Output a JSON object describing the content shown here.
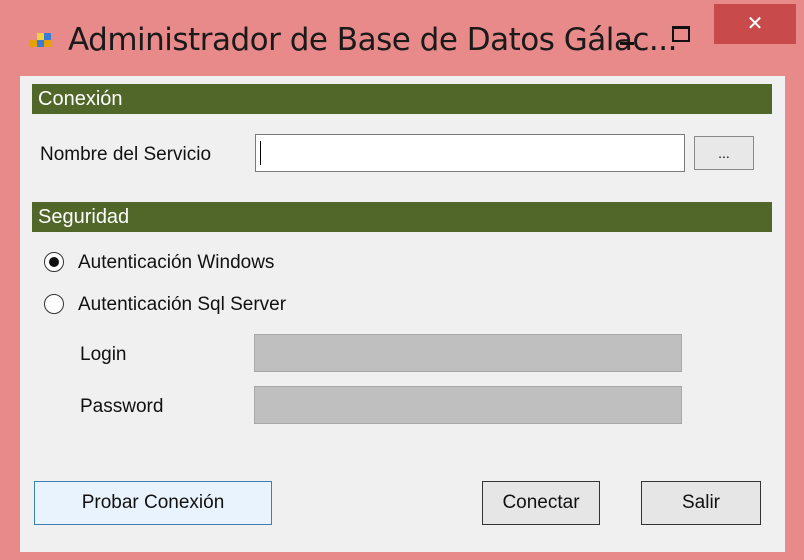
{
  "window": {
    "title": "Administrador de Base de Datos Gálac...",
    "close_glyph": "✕",
    "icons": {
      "app": "app-icon",
      "minimize": "minimize-icon",
      "maximize": "maximize-icon",
      "close": "close-icon"
    },
    "colors": {
      "frame": "#e98a8a",
      "close": "#c94a4a",
      "section": "#51672a"
    }
  },
  "conexion": {
    "header": "Conexión",
    "service_label": "Nombre del Servicio",
    "service_value": "",
    "browse_label": "..."
  },
  "seguridad": {
    "header": "Seguridad",
    "windows_auth_label": "Autenticación Windows",
    "windows_auth_checked": true,
    "sql_auth_label": "Autenticación Sql Server",
    "sql_auth_checked": false,
    "login_label": "Login",
    "login_value": "",
    "password_label": "Password",
    "password_value": ""
  },
  "buttons": {
    "test": "Probar Conexión",
    "connect": "Conectar",
    "exit": "Salir"
  }
}
